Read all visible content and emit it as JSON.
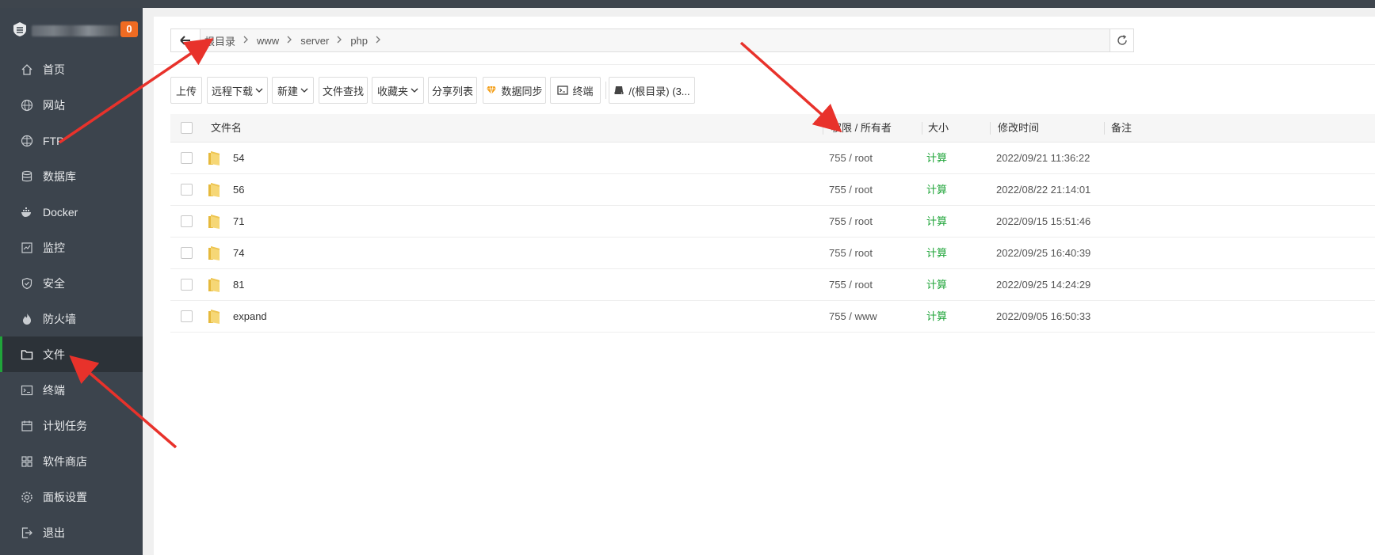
{
  "brand": {
    "badge": "0"
  },
  "sidebar": {
    "items": [
      {
        "label": "首页",
        "icon": "home-icon"
      },
      {
        "label": "网站",
        "icon": "globe-icon"
      },
      {
        "label": "FTP",
        "icon": "ftp-icon"
      },
      {
        "label": "数据库",
        "icon": "database-icon"
      },
      {
        "label": "Docker",
        "icon": "docker-icon"
      },
      {
        "label": "监控",
        "icon": "monitor-icon"
      },
      {
        "label": "安全",
        "icon": "shield-icon"
      },
      {
        "label": "防火墙",
        "icon": "firewall-icon"
      },
      {
        "label": "文件",
        "icon": "folder-icon"
      },
      {
        "label": "终端",
        "icon": "terminal-icon"
      },
      {
        "label": "计划任务",
        "icon": "calendar-icon"
      },
      {
        "label": "软件商店",
        "icon": "apps-icon"
      },
      {
        "label": "面板设置",
        "icon": "gear-icon"
      },
      {
        "label": "退出",
        "icon": "logout-icon"
      }
    ],
    "active": "文件"
  },
  "breadcrumb": [
    "根目录",
    "www",
    "server",
    "php"
  ],
  "toolbar": {
    "upload": "上传",
    "remote_download": "远程下载",
    "new": "新建",
    "file_search": "文件查找",
    "favorites": "收藏夹",
    "share_list": "分享列表",
    "data_sync": "数据同步",
    "terminal": "终端",
    "disk": "/(根目录) (3..."
  },
  "table": {
    "headers": {
      "name": "文件名",
      "perm": "权限 / 所有者",
      "size": "大小",
      "mtime": "修改时间",
      "note": "备注"
    },
    "rows": [
      {
        "name": "54",
        "perm": "755 / root",
        "size": "计算",
        "mtime": "2022/09/21 11:36:22"
      },
      {
        "name": "56",
        "perm": "755 / root",
        "size": "计算",
        "mtime": "2022/08/22 21:14:01"
      },
      {
        "name": "71",
        "perm": "755 / root",
        "size": "计算",
        "mtime": "2022/09/15 15:51:46"
      },
      {
        "name": "74",
        "perm": "755 / root",
        "size": "计算",
        "mtime": "2022/09/25 16:40:39"
      },
      {
        "name": "81",
        "perm": "755 / root",
        "size": "计算",
        "mtime": "2022/09/25 14:24:29"
      },
      {
        "name": "expand",
        "perm": "755 / www",
        "size": "计算",
        "mtime": "2022/09/05 16:50:33"
      }
    ]
  },
  "colors": {
    "accent": "#20a53a",
    "sidebar_bg": "#3c444d",
    "badge": "#ef6b22",
    "annotation_arrow": "#e8322b"
  }
}
